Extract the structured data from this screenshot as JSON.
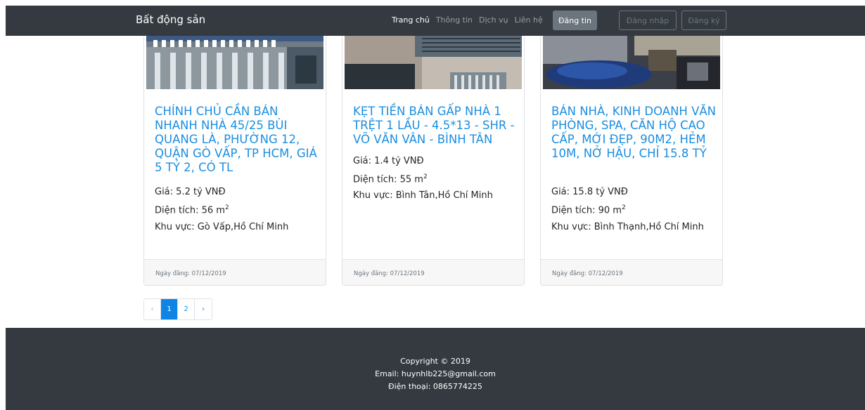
{
  "navbar": {
    "brand": "Bất động sản",
    "links": [
      "Trang chủ",
      "Thông tin",
      "Dịch vụ",
      "Liên hệ"
    ],
    "post_button": "Đăng tin",
    "login_button": "Đăng nhập",
    "register_button": "Đăng ký"
  },
  "listings": [
    {
      "title": "CHÍNH CHỦ CẦN BÁN NHANH NHÀ 45/25 BÙI QUANG LÀ, PHƯỜNG 12, QUẬN GÒ VẤP, TP HCM, GIÁ 5 TỶ 2, CÓ TL",
      "price": "Giá: 5.2 tỷ VNĐ",
      "area_label": "Diện tích: 56 m",
      "area_sup": "2",
      "region": "Khu vực: Gò Vấp,Hồ Chí Minh",
      "date": "Ngày đăng: 07/12/2019"
    },
    {
      "title": "KẸT TIỀN BÁN GẤP NHÀ 1 TRỆT 1 LẦU - 4.5*13 - SHR - VÕ VĂN VÂN - BÌNH TÂN",
      "price": "Giá: 1.4 tỷ VNĐ",
      "area_label": "Diện tích: 55 m",
      "area_sup": "2",
      "region": "Khu vực: Bình Tân,Hồ Chí Minh",
      "date": "Ngày đăng: 07/12/2019"
    },
    {
      "title": "BÁN NHÀ, KINH DOANH VĂN PHÒNG, SPA, CĂN HỘ CAO CẤP, MỚI ĐẸP, 90M2, HẺM 10M, NỞ HẬU, CHỈ 15.8 TỶ",
      "price": "Giá: 15.8 tỷ VNĐ",
      "area_label": "Diện tích: 90 m",
      "area_sup": "2",
      "region": "Khu vực: Bình Thạnh,Hồ Chí Minh",
      "date": "Ngày đăng: 07/12/2019"
    }
  ],
  "pagination": {
    "prev": "‹",
    "pages": [
      "1",
      "2"
    ],
    "next": "›"
  },
  "footer": {
    "copyright": "Copyright © 2019",
    "email": "Email: huynhlb225@gmail.com",
    "phone": "Điện thoại: 0865774225"
  }
}
